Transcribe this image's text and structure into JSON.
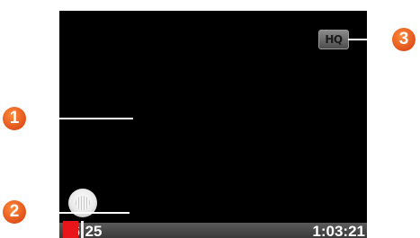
{
  "player": {
    "quality_badge": "HQ",
    "elapsed_time": "06:25",
    "total_time": "1:03:21",
    "progress_fraction": 0.101
  },
  "callouts": [
    "1",
    "2",
    "3"
  ],
  "colors": {
    "callout": "#e8591f",
    "progress": "#e8151b",
    "screen": "#000000"
  }
}
